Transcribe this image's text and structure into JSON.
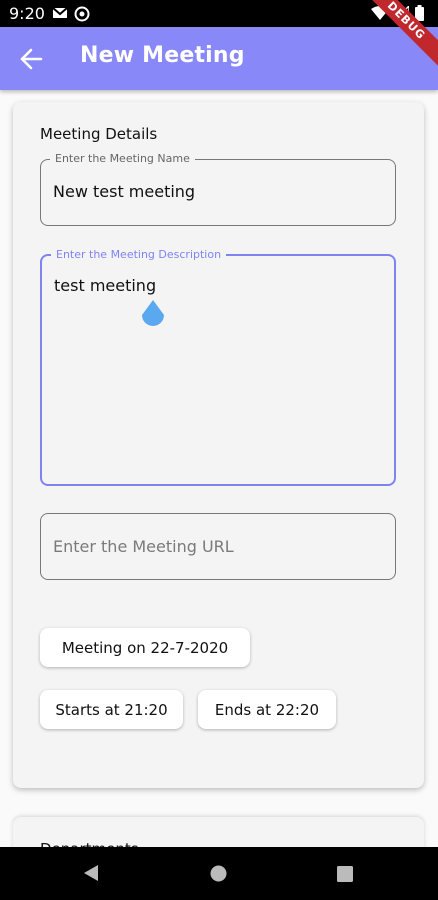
{
  "status_bar": {
    "time": "9:20"
  },
  "debug_banner": "DEBUG",
  "app_bar": {
    "title": "New Meeting"
  },
  "meeting_details": {
    "heading": "Meeting Details",
    "name_field": {
      "label": "Enter the Meeting Name",
      "value": "New test meeting"
    },
    "description_field": {
      "label": "Enter the Meeting Description",
      "value": "test meeting"
    },
    "url_field": {
      "placeholder": "Enter the Meeting URL"
    },
    "date_button": "Meeting on 22-7-2020",
    "start_button": "Starts at 21:20",
    "end_button": "Ends at 22:20"
  },
  "departments": {
    "heading": "Departments"
  },
  "colors": {
    "app_bar": "#8888f8",
    "focus": "#7f83f2",
    "card": "#f4f4f4",
    "cursor_handle": "#5aa9f0"
  }
}
